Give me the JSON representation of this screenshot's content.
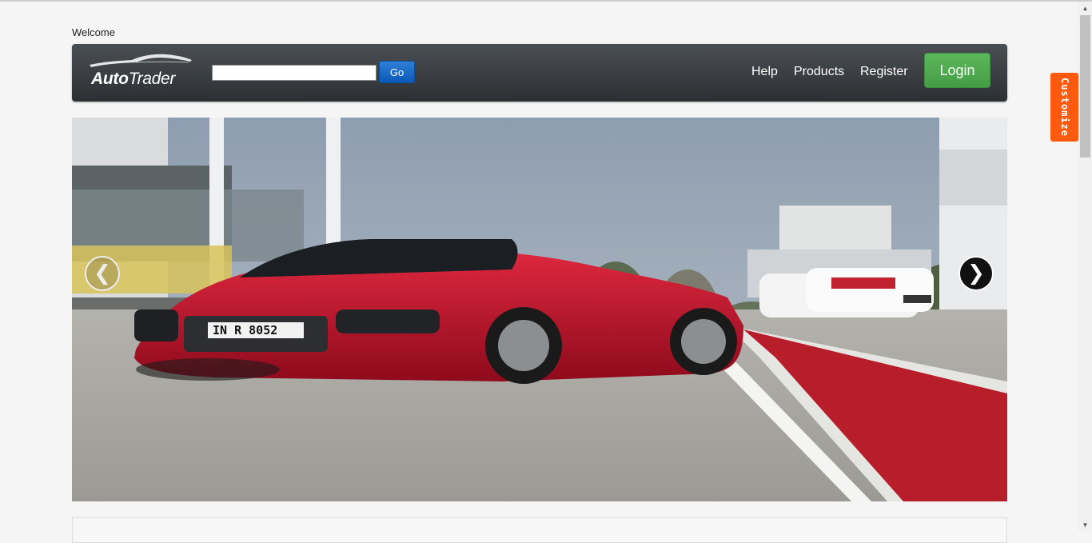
{
  "header": {
    "welcome": "Welcome"
  },
  "navbar": {
    "logo": {
      "part1": "Auto",
      "part2": "Trader"
    },
    "search": {
      "value": "",
      "placeholder": ""
    },
    "go_label": "Go",
    "links": [
      "Help",
      "Products",
      "Register"
    ],
    "login_label": "Login"
  },
  "carousel": {
    "prev_icon": "❮",
    "next_icon": "❯",
    "slide": {
      "plate": "IN R 8052"
    }
  },
  "side_tab": {
    "label": "Customize"
  },
  "colors": {
    "navbar_bg": "#3b4043",
    "go_button": "#0b59b8",
    "login_button": "#5cb85c",
    "customize_tab": "#ff5a0e",
    "car_body": "#c8102e"
  },
  "icons": {
    "prev": "chevron-left-icon",
    "next": "chevron-right-icon",
    "logo": "car-outline-icon",
    "scroll_up": "scroll-up-icon",
    "scroll_down": "scroll-down-icon"
  }
}
